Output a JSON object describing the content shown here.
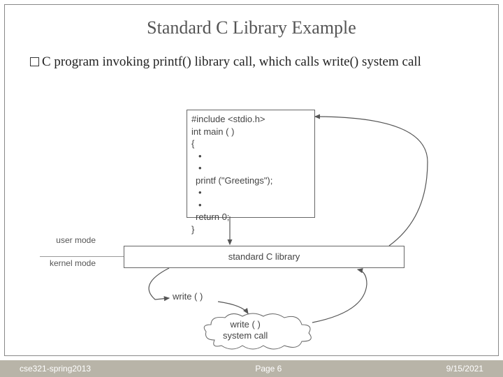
{
  "title": "Standard C Library Example",
  "body_text": "C program invoking printf() library call, which calls write() system call",
  "code": {
    "l1": "#include <stdio.h>",
    "l2": "int main ( )",
    "l3": "{",
    "l4": "•",
    "l5": "•",
    "l6": "printf (\"Greetings\");",
    "l7": "•",
    "l8": "•",
    "l9": "return 0;",
    "l10": "}"
  },
  "lib_label": "standard C library",
  "user_mode": "user mode",
  "kernel_mode": "kernel mode",
  "write_label": "write ( )",
  "cloud_l1": "write ( )",
  "cloud_l2": "system call",
  "footer": {
    "left": "cse321-spring2013",
    "center": "Page 6",
    "right": "9/15/2021"
  }
}
